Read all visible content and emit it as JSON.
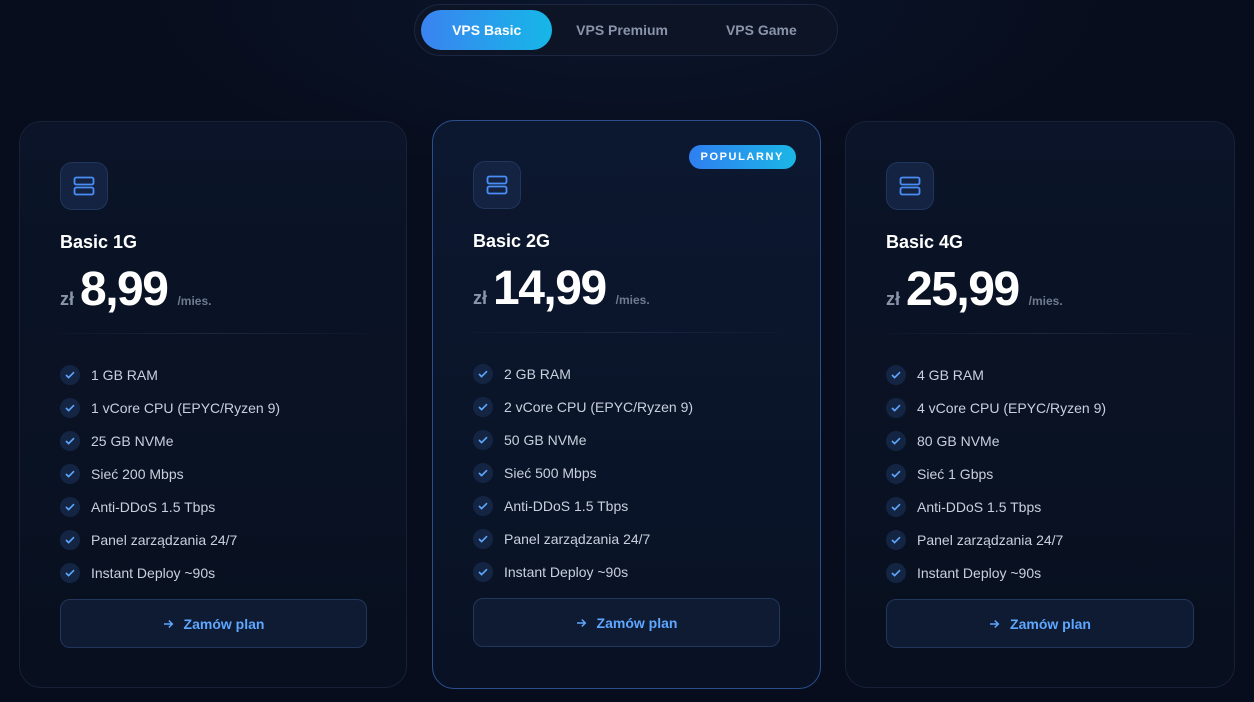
{
  "tabs": [
    {
      "label": "VPS Basic",
      "active": true
    },
    {
      "label": "VPS Premium",
      "active": false
    },
    {
      "label": "VPS Game",
      "active": false
    }
  ],
  "plans": [
    {
      "name": "Basic 1G",
      "currency": "zł",
      "price": "8,99",
      "period": "/mies.",
      "badge": "",
      "features": [
        "1 GB RAM",
        "1 vCore CPU (EPYC/Ryzen 9)",
        "25 GB NVMe",
        "Sieć 200 Mbps",
        "Anti-DDoS 1.5 Tbps",
        "Panel zarządzania 24/7",
        "Instant Deploy ~90s"
      ],
      "cta": "Zamów plan"
    },
    {
      "name": "Basic 2G",
      "currency": "zł",
      "price": "14,99",
      "period": "/mies.",
      "badge": "POPULARNY",
      "features": [
        "2 GB RAM",
        "2 vCore CPU (EPYC/Ryzen 9)",
        "50 GB NVMe",
        "Sieć 500 Mbps",
        "Anti-DDoS 1.5 Tbps",
        "Panel zarządzania 24/7",
        "Instant Deploy ~90s"
      ],
      "cta": "Zamów plan"
    },
    {
      "name": "Basic 4G",
      "currency": "zł",
      "price": "25,99",
      "period": "/mies.",
      "badge": "",
      "features": [
        "4 GB RAM",
        "4 vCore CPU (EPYC/Ryzen 9)",
        "80 GB NVMe",
        "Sieć 1 Gbps",
        "Anti-DDoS 1.5 Tbps",
        "Panel zarządzania 24/7",
        "Instant Deploy ~90s"
      ],
      "cta": "Zamów plan"
    }
  ],
  "icons": {
    "plan": "server-icon",
    "feature": "check-icon",
    "cta": "arrow-right-icon"
  },
  "colors": {
    "accent_start": "#3a83f0",
    "accent_end": "#16b7e8",
    "cta_text": "#5ea7ff",
    "background": "#070d1c"
  }
}
